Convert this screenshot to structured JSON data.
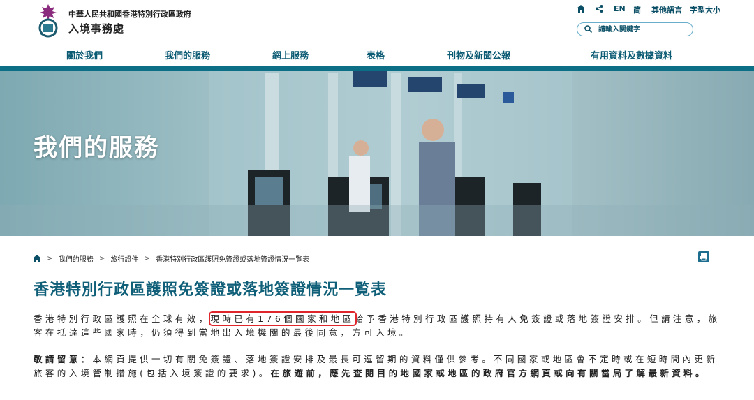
{
  "header": {
    "gov_line1": "中華人民共和國香港特別行政區政府",
    "gov_line2": "入境事務處",
    "utilities": {
      "lang_en": "EN",
      "lang_sc": "简",
      "other_lang": "其他語言",
      "font_size": "字型大小"
    },
    "search": {
      "placeholder": "請輸入關鍵字"
    }
  },
  "nav": {
    "items": [
      {
        "label": "關於我們"
      },
      {
        "label": "我們的服務"
      },
      {
        "label": "網上服務"
      },
      {
        "label": "表格"
      },
      {
        "label": "刊物及新聞公報"
      },
      {
        "label": "有用資料及數據資料"
      }
    ]
  },
  "banner": {
    "title": "我們的服務"
  },
  "breadcrumb": {
    "items": [
      {
        "label": "我們的服務"
      },
      {
        "label": "旅行證件"
      },
      {
        "label": "香港特別行政區護照免簽證或落地簽證情況一覧表"
      }
    ],
    "separator": ">"
  },
  "main": {
    "title": "香港特別行政區護照免簽證或落地簽證情況一覧表",
    "para1": {
      "before": "香港特別行政區護照在全球有效，",
      "highlight": "現時已有176個國家和地區",
      "after": "給予香港特別行政區護照持有人免簽證或落地簽證安排。但請注意，旅客在抵達這些國家時，仍須得到當地出入境機關的最後同意，方可入境。"
    },
    "para2": {
      "bold_lead": "敬請留意：",
      "text": "本網頁提供一切有關免簽證、落地簽證安排及最長可逗留期的資料僅供參考。不同國家或地區會不定時或在短時間內更新旅客的入境管制措施(包括入境簽證的要求)。",
      "bold_tail": "在旅遊前，應先查閱目的地國家或地區的政府官方網頁或向有關當局了解最新資料。"
    }
  },
  "colors": {
    "accent": "#0f5f78",
    "highlight_border": "#e0262d",
    "nav_text": "#0b5a73"
  }
}
